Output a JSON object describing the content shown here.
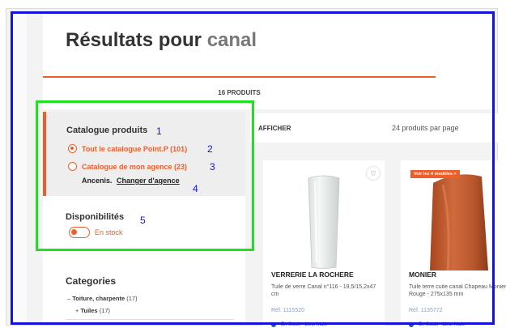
{
  "page": {
    "title_prefix": "Résultats pour",
    "query": "canal",
    "product_count": "16",
    "products_tab_label": "PRODUITS"
  },
  "filters": {
    "catalogue_title": "Catalogue produits",
    "options": [
      {
        "label": "Tout le catalogue Point.P (101)",
        "selected": true
      },
      {
        "label": "Catalogue de mon agence (23)",
        "selected": false
      }
    ],
    "agency_city": "Ancenis.",
    "change_agency_label": "Changer d'agence",
    "availability_title": "Disponibilités",
    "in_stock_label": "En stock",
    "categories_title": "Categories",
    "category_items": [
      {
        "prefix": "–",
        "name": "Toiture, charpente",
        "count": "(17)"
      },
      {
        "prefix": "+",
        "name": "Tuiles",
        "count": "(17)"
      }
    ]
  },
  "results": {
    "afficher_label": "AFFICHER",
    "per_page_label": "24 produits par page"
  },
  "products": [
    {
      "name": "VERRERIE LA ROCHERE",
      "description": "Tuile de verre Canal n°116 - 19,5/15,2x47 cm",
      "ref": "Réf. 1115520",
      "stock": "En Stock - Lieu: Maie",
      "badge": ""
    },
    {
      "name": "MONIER",
      "description": "Tuile terre cuite canal Chapeau Monier Rouge - 275x135 mm",
      "ref": "Réf. 1135772",
      "stock": "En Stock - Lieu: Maie",
      "badge": "Voir les 4 modèles >"
    }
  ],
  "annotations": [
    "1",
    "2",
    "3",
    "4",
    "5"
  ],
  "colors": {
    "accent": "#ee5e2b",
    "highlight_green": "#21e021",
    "frame_blue": "#1414d8",
    "stock_dot": "#1a5cad"
  }
}
